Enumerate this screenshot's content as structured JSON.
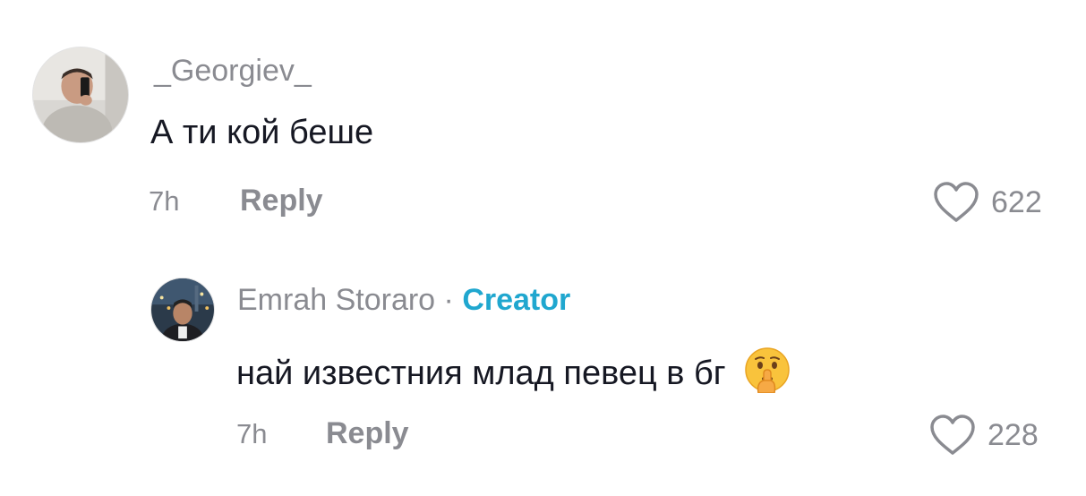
{
  "comments": [
    {
      "username": "_Georgiev_",
      "text": "А ти кой беше",
      "time": "7h",
      "reply_label": "Reply",
      "likes": "622",
      "avatar_icon": "profile-photo"
    }
  ],
  "reply": {
    "username": "Emrah Storaro",
    "separator": "·",
    "creator_label": "Creator",
    "text": "най известния млад певец в бг",
    "emoji_icon": "shushing-face-emoji",
    "time": "7h",
    "reply_label": "Reply",
    "likes": "228",
    "avatar_icon": "profile-photo"
  },
  "colors": {
    "secondary_text": "#8a8b91",
    "primary_text": "#161823",
    "creator": "#20a7cf"
  }
}
